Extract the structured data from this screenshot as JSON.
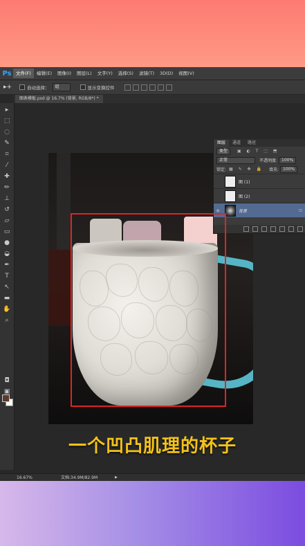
{
  "app": {
    "logo": "Ps"
  },
  "menu": [
    "文件(F)",
    "编辑(E)",
    "图像(I)",
    "图层(L)",
    "文字(Y)",
    "选择(S)",
    "滤镜(T)",
    "3D(D)",
    "视图(V)"
  ],
  "options_bar": {
    "tool_glyph": "▸+",
    "auto_select": "自动选择：",
    "auto_select_value": "组",
    "show_transform": "显示变换控件"
  },
  "document_tab": "图表模板.psd @ 16.7% (背景, RGB/8*) *",
  "toolbar_icons": [
    "move-icon",
    "marquee-icon",
    "lasso-icon",
    "quick-select-icon",
    "crop-icon",
    "eyedropper-icon",
    "heal-icon",
    "brush-icon",
    "stamp-icon",
    "history-brush-icon",
    "eraser-icon",
    "gradient-icon",
    "blur-icon",
    "dodge-icon",
    "pen-icon",
    "type-icon",
    "path-select-icon",
    "shape-icon",
    "hand-icon",
    "zoom-icon"
  ],
  "layers_panel": {
    "tabs": [
      "图层",
      "通道",
      "路径"
    ],
    "filter": "类型",
    "blend_mode": "正常",
    "opacity_label": "不透明度:",
    "opacity_value": "100%",
    "lock_label": "锁定:",
    "fill_label": "填充:",
    "fill_value": "100%",
    "layers": [
      {
        "name": "图 (1)",
        "selected": false
      },
      {
        "name": "图 (2)",
        "selected": false
      },
      {
        "name": "背景",
        "selected": true
      }
    ]
  },
  "caption": "一个凹凸肌理的杯子",
  "status": {
    "zoom": "16.67%",
    "doc": "文档:34.9M/82.9M"
  },
  "colors": {
    "highlight_box": "#e02424",
    "caption": "#f4c21c",
    "selected_layer": "#536b92"
  }
}
